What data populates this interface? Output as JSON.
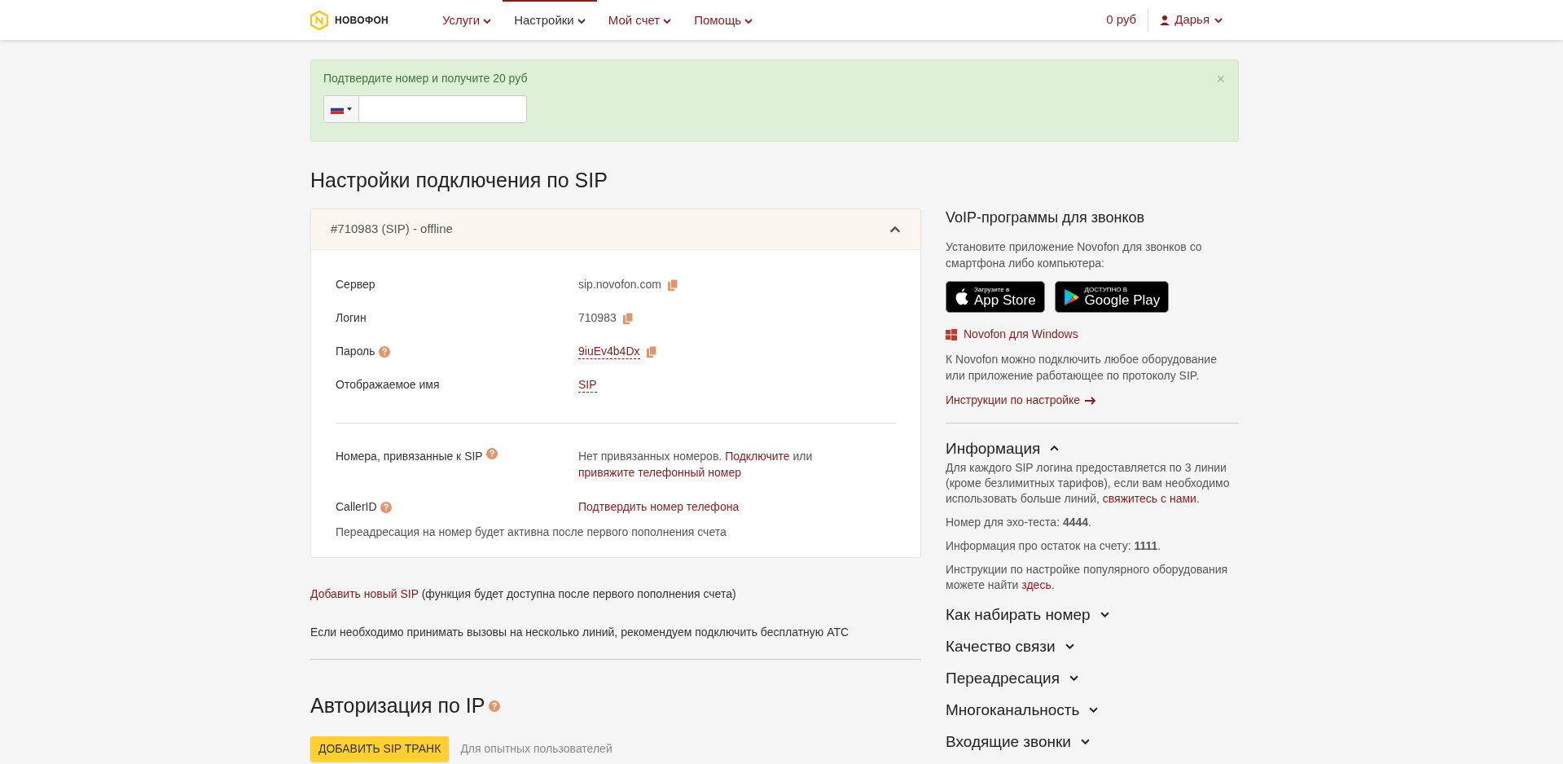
{
  "header": {
    "logo": "НОВОФОН",
    "nav": [
      {
        "label": "Услуги",
        "selected": false
      },
      {
        "label": "Настройки",
        "selected": true
      },
      {
        "label": "Мой счет",
        "selected": false
      },
      {
        "label": "Помощь",
        "selected": false
      }
    ],
    "balance": "0 руб",
    "user": "Дарья"
  },
  "banner": {
    "text": "Подтвердите номер и получите 20 руб",
    "close": "×"
  },
  "title": "Настройки подключения по SIP",
  "sip_card": {
    "header": "#710983 (SIP) - offline",
    "expanded": true,
    "rows": [
      {
        "label": "Сервер",
        "value": "sip.novofon.com",
        "kind": "plain",
        "help": false,
        "copy": true
      },
      {
        "label": "Логин",
        "value": "710983",
        "kind": "plain",
        "help": false,
        "copy": true
      },
      {
        "label": "Пароль",
        "value": "9iuEv4b4Dx",
        "kind": "editable",
        "help": true,
        "copy": true
      },
      {
        "label": "Отображаемое имя",
        "value": "SIP",
        "kind": "editable",
        "help": false,
        "copy": false
      }
    ],
    "numbers": {
      "label": "Номера, привязанные к SIP",
      "segments": [
        {
          "kind": "text",
          "text": "Нет привязанных номеров."
        },
        {
          "kind": "link",
          "text": "Подключите"
        },
        {
          "kind": "text",
          "text": "или"
        },
        {
          "kind": "link",
          "text": "привяжите телефонный номер"
        }
      ]
    },
    "callerid": {
      "label": "CallerID",
      "link": "Подтвердить номер телефона"
    },
    "note": "Переадресация на номер будет активна после первого пополнения счета"
  },
  "add_sip": {
    "link": "Добавить новый SIP",
    "text": "(функция будет доступна после первого пополнения счета)"
  },
  "recommend": "Если необходимо принимать вызовы на несколько линий, рекомендуем подключить бесплатную АТС",
  "ip_auth": {
    "title": "Авторизация по IP",
    "button": "ДОБАВИТЬ SIP ТРАНК",
    "hint": "Для опытных пользователей"
  },
  "sidebar": {
    "voip_title": "VoIP-программы для звонков",
    "voip_text": "Установите приложение Novofon для звонков со смартфона либо компьютера:",
    "stores": [
      {
        "kind": "apple",
        "small": "Загрузите в",
        "big": "App Store"
      },
      {
        "kind": "google",
        "small": "ДОСТУПНО В",
        "big": "Google Play"
      }
    ],
    "windows_link": "Novofon для Windows",
    "equipment_text": "К Novofon можно подключить любое оборудование или приложение работающее по протоколу SIP.",
    "instructions_link": "Инструкции по настройке",
    "sections": [
      {
        "title": "Информация",
        "expanded": true,
        "paragraphs": [
          [
            {
              "kind": "text",
              "text": "Для каждого SIP логина предоставляется по 3 линии (кроме безлимитных тарифов), если вам необходимо использовать больше линий,"
            },
            {
              "kind": "link",
              "text": "свяжитесь с нами"
            },
            {
              "kind": "text",
              "text": "."
            }
          ],
          [
            {
              "kind": "text",
              "text": "Номер для эхо-теста: **4444**."
            }
          ],
          [
            {
              "kind": "text",
              "text": "Информация про остаток на счету: **1111**."
            }
          ],
          [
            {
              "kind": "text",
              "text": "Инструкции по настройке популярного оборудования можете найти"
            },
            {
              "kind": "link",
              "text": "здесь"
            },
            {
              "kind": "text",
              "text": "."
            }
          ]
        ]
      },
      {
        "title": "Как набирать номер",
        "expanded": false
      },
      {
        "title": "Качество связи",
        "expanded": false
      },
      {
        "title": "Переадресация",
        "expanded": false
      },
      {
        "title": "Многоканальность",
        "expanded": false
      },
      {
        "title": "Входящие звонки",
        "expanded": false
      }
    ]
  }
}
